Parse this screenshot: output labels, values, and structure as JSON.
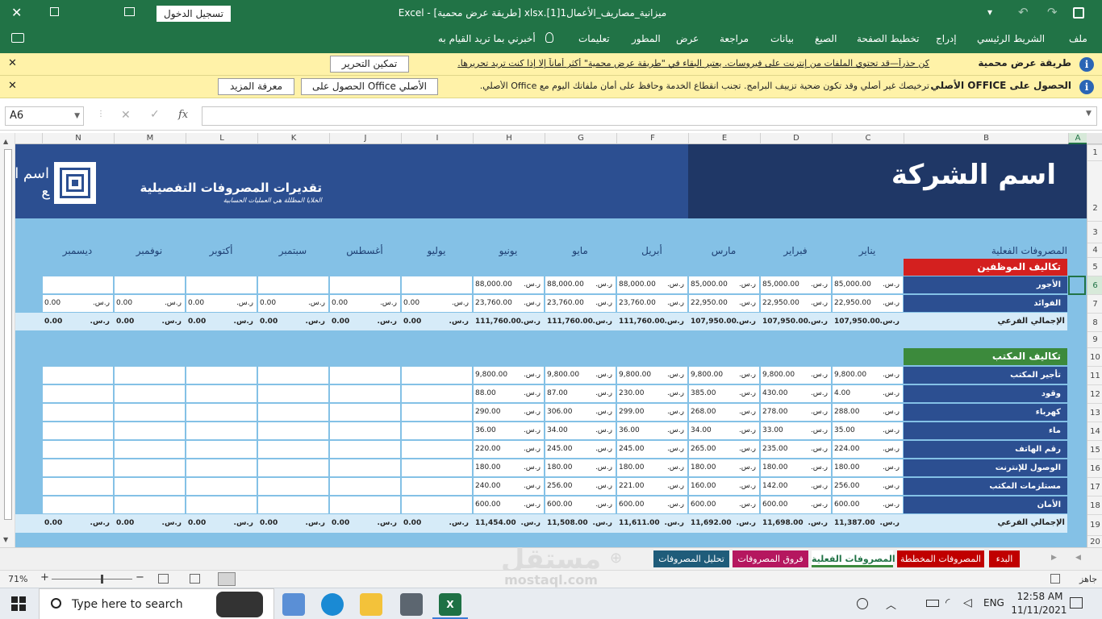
{
  "titlebar": {
    "title": "ميزانية_مصاريف_الأعمال1[1].xlsx  [طريقة عرض محمية]  -  Excel",
    "signin": "تسجيل الدخول"
  },
  "ribbon": {
    "tabs": [
      "ملف",
      "الشريط الرئيسي",
      "إدراج",
      "تخطيط الصفحة",
      "الصيغ",
      "بيانات",
      "مراجعة",
      "عرض",
      "المطور",
      "تعليمات"
    ],
    "tellme": "أخبرني بما تريد القيام به"
  },
  "protected": {
    "title": "طريقة عرض محمية",
    "message": "كن حذراً—قد تحتوي الملفات من إنترنت على فيروسات. يعتبر البقاء في \"طريقة عرض محمية\" أكثر أماناً إلا إذا كنت تريد تحريرها.",
    "button": "تمكين التحرير"
  },
  "genuine": {
    "title": "الحصول على OFFICE الأصلي",
    "message": "ترخيصك غير أصلي وقد تكون ضحية تزييف البرامج. تجنب انقطاع الخدمة وحافظ على أمان ملفاتك اليوم مع Office الأصلي.",
    "button1": "الحصول على Office الأصلي",
    "button2": "معرفة المزيد"
  },
  "formula": {
    "namebox": "A6",
    "fx": "fx",
    "value": ""
  },
  "columns": [
    "A",
    "B",
    "C",
    "D",
    "E",
    "F",
    "G",
    "H",
    "I",
    "J",
    "K",
    "L",
    "M",
    "N"
  ],
  "rows": [
    "1",
    "2",
    "3",
    "4",
    "5",
    "6",
    "7",
    "8",
    "9",
    "10",
    "11",
    "12",
    "13",
    "14",
    "15",
    "16",
    "17",
    "18",
    "19",
    "20"
  ],
  "sheet": {
    "company": "اسم الشركة",
    "subtitle": "تقديرات المصروفات التفصيلية",
    "tagline": "الخلايا المظللة هي العمليات الحسابية",
    "logo_text": "اسم الشع",
    "actual_label": "المصروفات الفعلية",
    "months": [
      "يناير",
      "فبراير",
      "مارس",
      "أبريل",
      "مايو",
      "يونيو",
      "يوليو",
      "أغسطس",
      "سبتمبر",
      "أكتوبر",
      "نوفمبر",
      "ديسمبر"
    ],
    "currency": "ر.س.",
    "employees": {
      "header": "تكاليف الموظفين",
      "rows": [
        {
          "label": "الأجور",
          "values": [
            "85,000.00",
            "85,000.00",
            "85,000.00",
            "88,000.00",
            "88,000.00",
            "88,000.00",
            "",
            "",
            "",
            "",
            "",
            ""
          ]
        },
        {
          "label": "الفوائد",
          "values": [
            "22,950.00",
            "22,950.00",
            "22,950.00",
            "23,760.00",
            "23,760.00",
            "23,760.00",
            "0.00",
            "0.00",
            "0.00",
            "0.00",
            "0.00",
            "0.00"
          ]
        }
      ],
      "subtotal_label": "الإجمالي الفرعي",
      "subtotals": [
        "107,950.00",
        "107,950.00",
        "107,950.00",
        "111,760.00",
        "111,760.00",
        "111,760.00",
        "0.00",
        "0.00",
        "0.00",
        "0.00",
        "0.00",
        "0.00"
      ]
    },
    "office": {
      "header": "تكاليف المكتب",
      "rows": [
        {
          "label": "تأجير المكتب",
          "values": [
            "9,800.00",
            "9,800.00",
            "9,800.00",
            "9,800.00",
            "9,800.00",
            "9,800.00",
            "",
            "",
            "",
            "",
            "",
            ""
          ]
        },
        {
          "label": "وقود",
          "values": [
            "4.00",
            "430.00",
            "385.00",
            "230.00",
            "87.00",
            "88.00",
            "",
            "",
            "",
            "",
            "",
            ""
          ]
        },
        {
          "label": "كهرباء",
          "values": [
            "288.00",
            "278.00",
            "268.00",
            "299.00",
            "306.00",
            "290.00",
            "",
            "",
            "",
            "",
            "",
            ""
          ]
        },
        {
          "label": "ماء",
          "values": [
            "35.00",
            "33.00",
            "34.00",
            "36.00",
            "34.00",
            "36.00",
            "",
            "",
            "",
            "",
            "",
            ""
          ]
        },
        {
          "label": "رقم الهاتف",
          "values": [
            "224.00",
            "235.00",
            "265.00",
            "245.00",
            "245.00",
            "220.00",
            "",
            "",
            "",
            "",
            "",
            ""
          ]
        },
        {
          "label": "الوصول للإنترنت",
          "values": [
            "180.00",
            "180.00",
            "180.00",
            "180.00",
            "180.00",
            "180.00",
            "",
            "",
            "",
            "",
            "",
            ""
          ]
        },
        {
          "label": "مستلزمات المكتب",
          "values": [
            "256.00",
            "142.00",
            "160.00",
            "221.00",
            "256.00",
            "240.00",
            "",
            "",
            "",
            "",
            "",
            ""
          ]
        },
        {
          "label": "الأمان",
          "values": [
            "600.00",
            "600.00",
            "600.00",
            "600.00",
            "600.00",
            "600.00",
            "",
            "",
            "",
            "",
            "",
            ""
          ]
        }
      ],
      "subtotal_label": "الإجمالي الفرعي",
      "subtotals": [
        "11,387.00",
        "11,698.00",
        "11,692.00",
        "11,611.00",
        "11,508.00",
        "11,454.00",
        "0.00",
        "0.00",
        "0.00",
        "0.00",
        "0.00",
        "0.00"
      ]
    }
  },
  "sheet_tabs": [
    {
      "label": "البدء",
      "color": "#c00000"
    },
    {
      "label": "المصروفات المخططة",
      "color": "#c00000"
    },
    {
      "label": "المصروفات الفعلية",
      "color": "#3c8a3c",
      "active": true
    },
    {
      "label": "فروق المصروفات",
      "color": "#b5175f"
    },
    {
      "label": "تحليل المصروفات",
      "color": "#1f5c7a"
    }
  ],
  "status": {
    "ready": "جاهز",
    "zoom": "71%"
  },
  "taskbar": {
    "search": "Type here to search",
    "lang": "ENG",
    "time": "12:58 AM",
    "date": "11/11/2021"
  },
  "watermark": {
    "brand": "مستقل",
    "site": "mostaql.com"
  }
}
